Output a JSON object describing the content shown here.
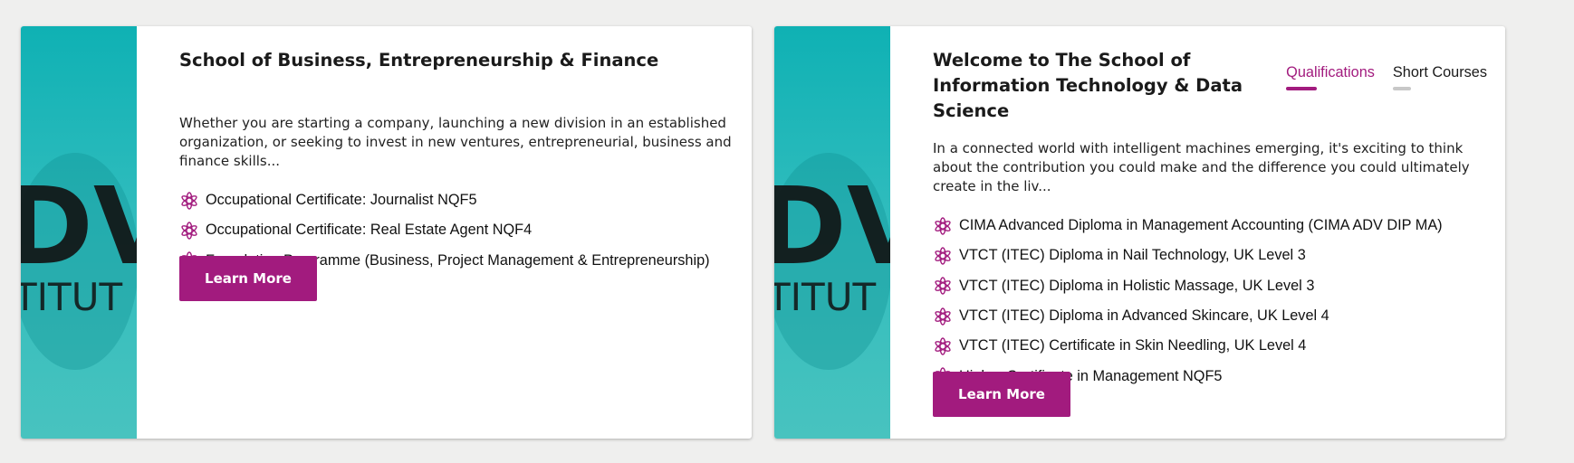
{
  "colors": {
    "accent": "#a21b7e",
    "teal": "#16b3b5",
    "background": "#efefee"
  },
  "cards": [
    {
      "image_icon": "institute-logo-image",
      "title": "School of Business, Entrepreneurship & Finance",
      "description": "Whether you are starting a company, launching a new division in an established organization, or seeking to invest in new ventures, entrepreneurial, business and finance skills...",
      "items": [
        "Occupational Certificate: Journalist NQF5",
        "Occupational Certificate: Real Estate Agent NQF4",
        "Foundation Programme (Business, Project Management & Entrepreneurship)"
      ],
      "button_label": "Learn More"
    },
    {
      "image_icon": "institute-logo-image",
      "title": "Welcome to The School of Information Technology & Data Science",
      "tabs": [
        {
          "label": "Qualifications",
          "active": true
        },
        {
          "label": "Short Courses",
          "active": false
        }
      ],
      "description": "In a connected world with intelligent machines emerging, it's exciting to think about the contribution you could make and the difference you could ultimately create in the liv...",
      "items": [
        "CIMA Advanced Diploma in Management Accounting (CIMA ADV DIP MA)",
        "VTCT (ITEC) Diploma in Nail Technology, UK Level 3",
        "VTCT (ITEC) Diploma in Holistic Massage, UK Level 3",
        "VTCT (ITEC) Diploma in Advanced Skincare, UK Level 4",
        "VTCT (ITEC) Certificate in Skin Needling, UK Level 4",
        "Higher Certificate in Management NQF5"
      ],
      "button_label": "Learn More"
    }
  ]
}
